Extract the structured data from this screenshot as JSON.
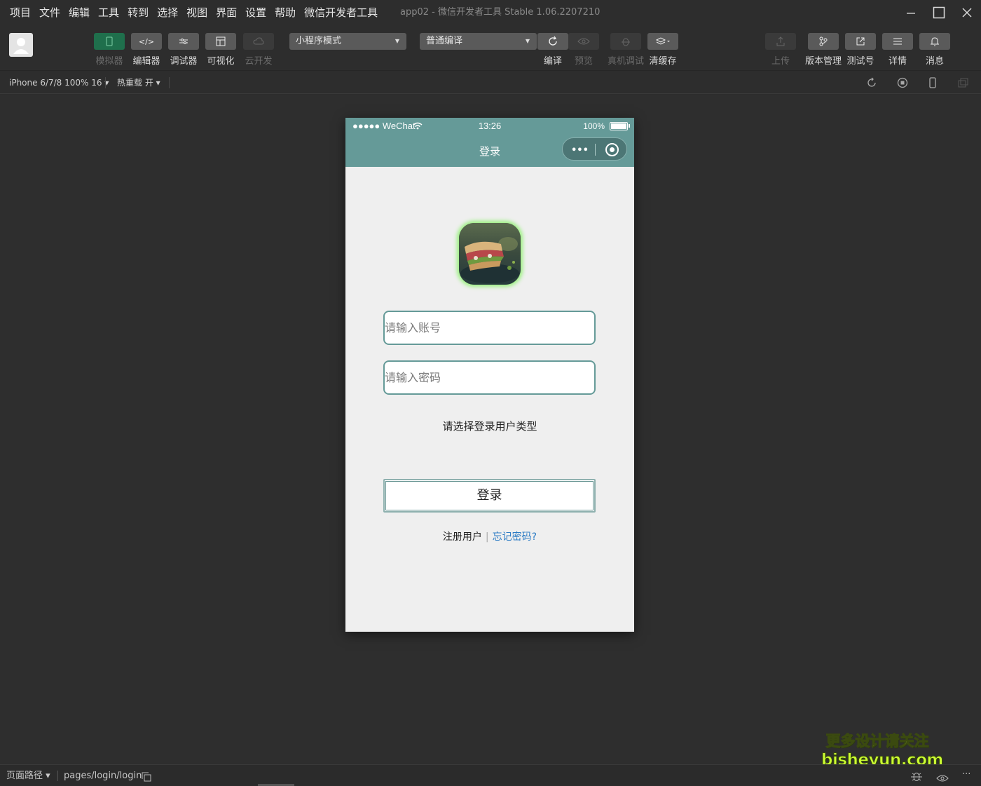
{
  "menu": [
    "项目",
    "文件",
    "编辑",
    "工具",
    "转到",
    "选择",
    "视图",
    "界面",
    "设置",
    "帮助",
    "微信开发者工具"
  ],
  "window": {
    "title": "app02 - 微信开发者工具 Stable 1.06.2207210"
  },
  "toolbar": {
    "simulator": "模拟器",
    "editor": "编辑器",
    "debugger": "调试器",
    "visual": "可视化",
    "cloud": "云开发",
    "mode_select": "小程序模式",
    "compile_select": "普通编译",
    "compile": "编译",
    "preview": "预览",
    "remote_debug": "真机调试",
    "clear_cache": "清缓存",
    "upload": "上传",
    "version": "版本管理",
    "test_account": "测试号",
    "details": "详情",
    "messages": "消息"
  },
  "devbar": {
    "device": "iPhone 6/7/8 100% 16 ▾",
    "hot_reload": "热重载 开 ▾"
  },
  "phone": {
    "carrier": "●●●●● WeChat",
    "time": "13:26",
    "battery": "100%",
    "nav_title": "登录",
    "capsule_more": "•••",
    "account_placeholder": "请输入账号",
    "password_placeholder": "请输入密码",
    "user_type_prompt": "请选择登录用户类型",
    "login_button": "登录",
    "register_link": "注册用户",
    "link_separator": "|",
    "forgot_link": "忘记密码?"
  },
  "bottombar": {
    "page_path_label": "页面路径 ▾",
    "page_path": "pages/login/login"
  },
  "watermark": {
    "line1": "更多设计请关注",
    "line2": "bisheyun.com"
  },
  "colors": {
    "accent_nav": "#659a98",
    "active_tool": "#1f6f4c",
    "link_blue": "#2b7bc4"
  }
}
